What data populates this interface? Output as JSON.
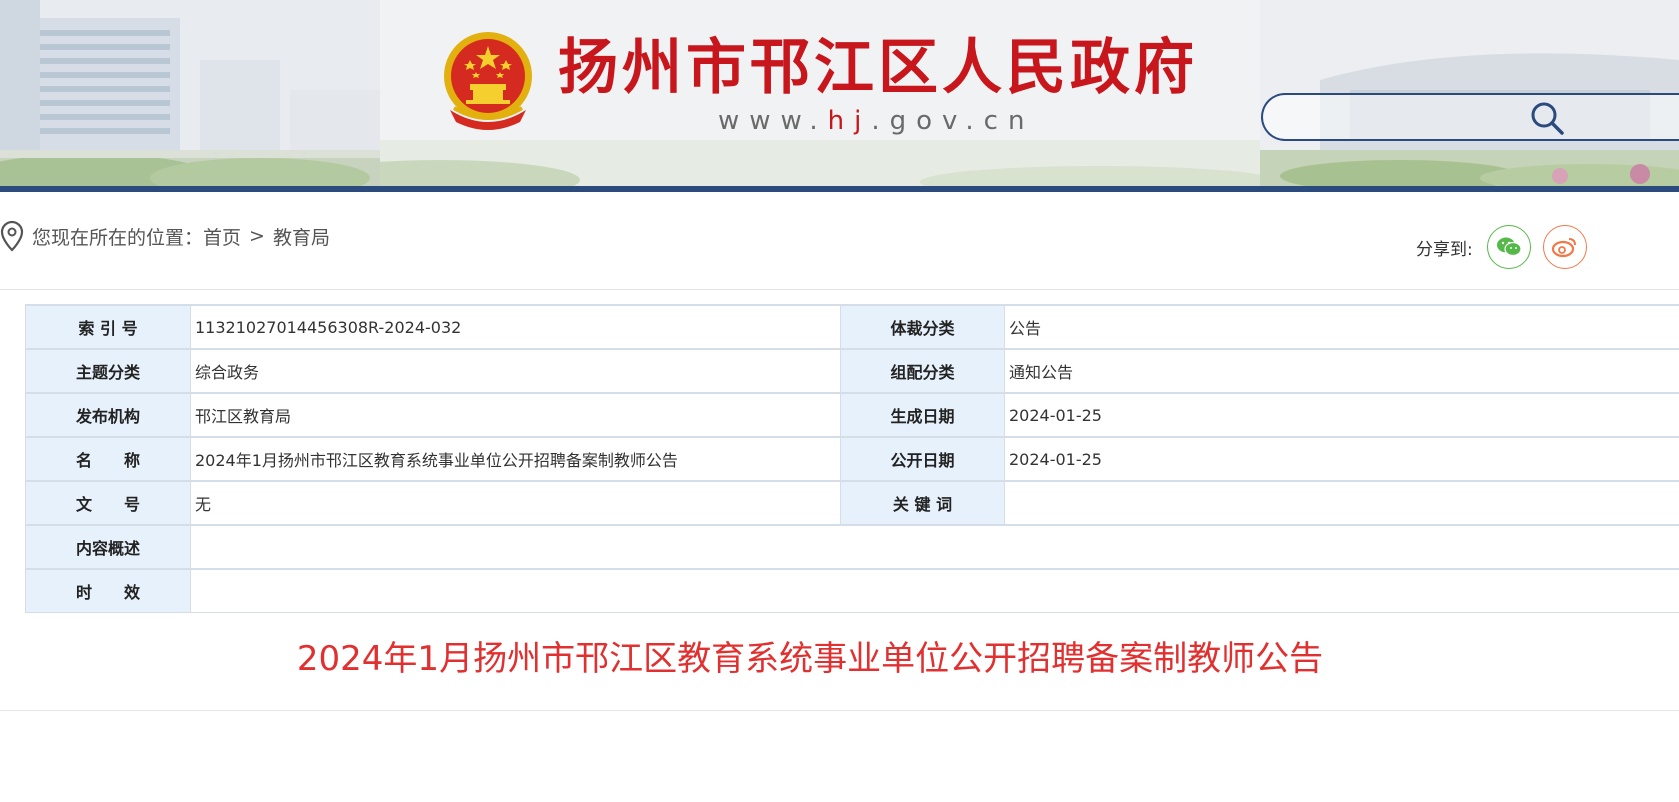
{
  "header": {
    "site_title": "扬州市邗江区人民政府",
    "site_url_prefix": "www.",
    "site_url_highlight": "hj",
    "site_url_suffix": ".gov.cn",
    "search_placeholder": "",
    "brand_color": "#c8161d",
    "bar_color": "#2b4a7e",
    "emblem_icon": "national-emblem-icon",
    "search_icon": "search-icon"
  },
  "breadcrumb": {
    "prefix": "您现在所在的位置：",
    "home": "首页",
    "separator": ">",
    "current": "教育局",
    "icon": "location-pin-icon"
  },
  "share": {
    "label": "分享到:",
    "targets": [
      "wechat-icon",
      "weibo-icon"
    ]
  },
  "meta": {
    "rows": [
      {
        "l1": "索 引 号",
        "v1": "11321027014456308R-2024-032",
        "l2": "体裁分类",
        "v2": "公告"
      },
      {
        "l1": "主题分类",
        "v1": "综合政务",
        "l2": "组配分类",
        "v2": "通知公告"
      },
      {
        "l1": "发布机构",
        "v1": "邗江区教育局",
        "l2": "生成日期",
        "v2": "2024-01-25"
      },
      {
        "l1": "名　　称",
        "v1": "2024年1月扬州市邗江区教育系统事业单位公开招聘备案制教师公告",
        "l2": "公开日期",
        "v2": "2024-01-25"
      },
      {
        "l1": "文　　号",
        "v1": "无",
        "l2": "关 键 词",
        "v2": ""
      }
    ],
    "summary_label": "内容概述",
    "summary_value": "",
    "validity_label": "时　　效",
    "validity_value": "",
    "label_bg": "#e7f1fb"
  },
  "article": {
    "title": "2024年1月扬州市邗江区教育系统事业单位公开招聘备案制教师公告",
    "title_color": "#e0302f"
  }
}
